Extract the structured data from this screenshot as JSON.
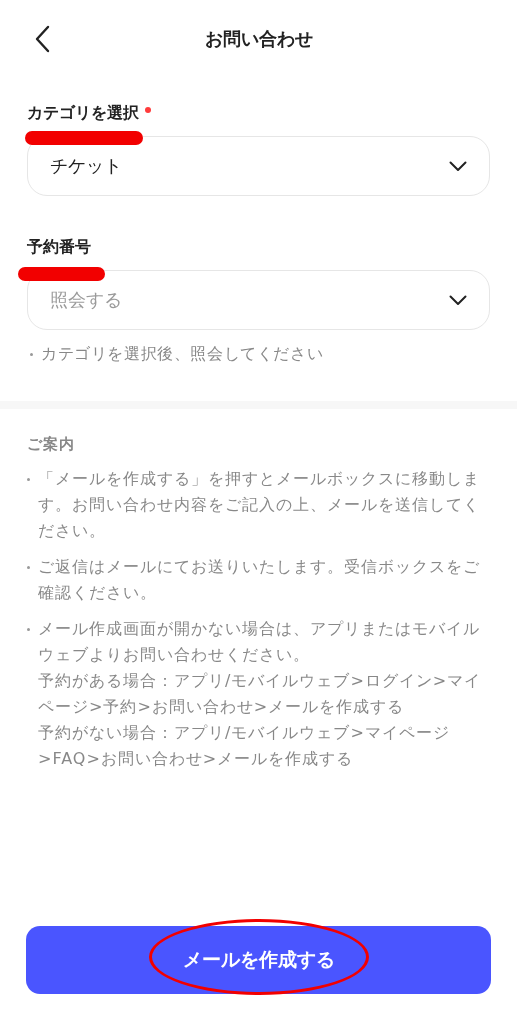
{
  "header": {
    "title": "お問い合わせ"
  },
  "fields": [
    {
      "label": "カテゴリを選択",
      "required": true,
      "value": "チケット"
    },
    {
      "label": "予約番号",
      "required": false,
      "placeholder": "照会する"
    }
  ],
  "helper": "カテゴリを選択後、照会してください",
  "guide": {
    "title": "ご案内",
    "items": [
      {
        "lines": [
          "「メールを作成する」を押すとメールボックスに移動します。お問い合わせ内容をご記入の上、メールを送信してください。"
        ]
      },
      {
        "lines": [
          "ご返信はメールにてお送りいたします。受信ボックスをご確認ください。"
        ]
      },
      {
        "lines": [
          "メール作成画面が開かない場合は、アプリまたはモバイルウェブよりお問い合わせください。",
          "予約がある場合：アプリ/モバイルウェブ>ログイン>マイページ>予約>お問い合わせ>メールを作成する",
          "予約がない場合：アプリ/モバイルウェブ>マイページ>FAQ>お問い合わせ>メールを作成する"
        ]
      }
    ]
  },
  "submit_button": "メールを作成する"
}
